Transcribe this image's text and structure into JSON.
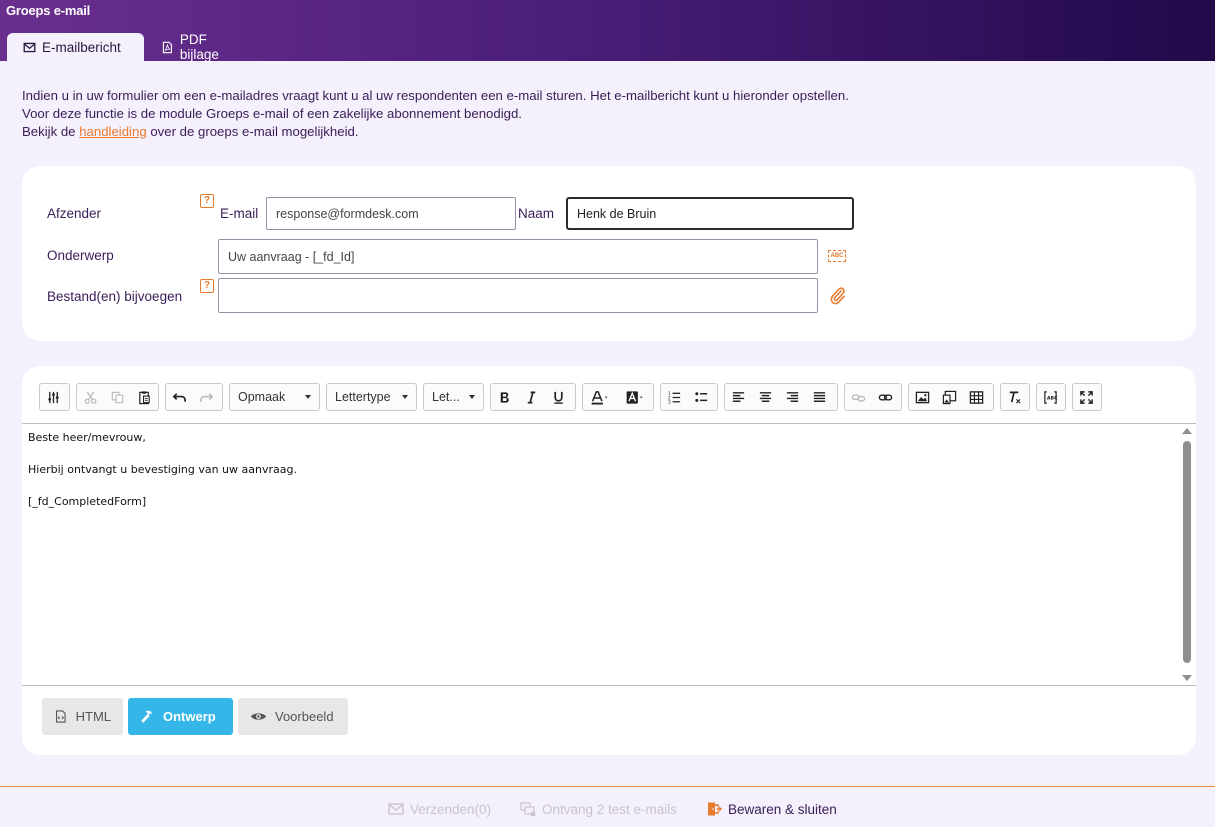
{
  "window": {
    "title": "Groeps e-mail"
  },
  "tabs": [
    {
      "label": "E-mailbericht",
      "icon": "envelope-icon",
      "active": true
    },
    {
      "label": "PDF bijlage",
      "icon": "pdf-icon",
      "active": false
    }
  ],
  "intro": {
    "line1": "Indien u in uw formulier om een e-mailadres vraagt kunt u al uw respondenten een e-mail sturen. Het e-mailbericht kunt u hieronder opstellen.",
    "line2": "Voor deze functie is de module Groeps e-mail of een zakelijke abonnement benodigd.",
    "line3_before": "Bekijk de",
    "line3_link": "handleiding",
    "line3_after": "over de groeps e-mail mogelijkheid."
  },
  "form": {
    "sender_label": "Afzender",
    "email_label": "E-mail",
    "email_value": "response@formdesk.com",
    "name_label": "Naam",
    "name_value": "Henk de Bruin",
    "subject_label": "Onderwerp",
    "subject_value": "Uw aanvraag - [_fd_Id]",
    "attach_label": "Bestand(en) bijvoegen",
    "attach_value": "",
    "help_mark": "?",
    "abc_mark": "ABC"
  },
  "toolbar": {
    "format_label": "Opmaak",
    "font_label": "Lettertype",
    "size_label": "Let..."
  },
  "editor": {
    "lines": [
      "Beste heer/mevrouw,",
      "Hierbij ontvangt u bevestiging van uw aanvraag.",
      "[_fd_CompletedForm]"
    ]
  },
  "modes": {
    "html": "HTML",
    "design": "Ontwerp",
    "preview": "Voorbeeld"
  },
  "footer": {
    "send_label": "Verzenden",
    "send_count": "(0)",
    "test_label": "Ontvang 2 test e-mails",
    "save_label": "Bewaren & sluiten"
  },
  "colors": {
    "accent": "#e97b2e",
    "brand_dark": "#21094a",
    "brand": "#6a2f8e",
    "design_button": "#35b6e8",
    "background": "#f4f0fc"
  }
}
